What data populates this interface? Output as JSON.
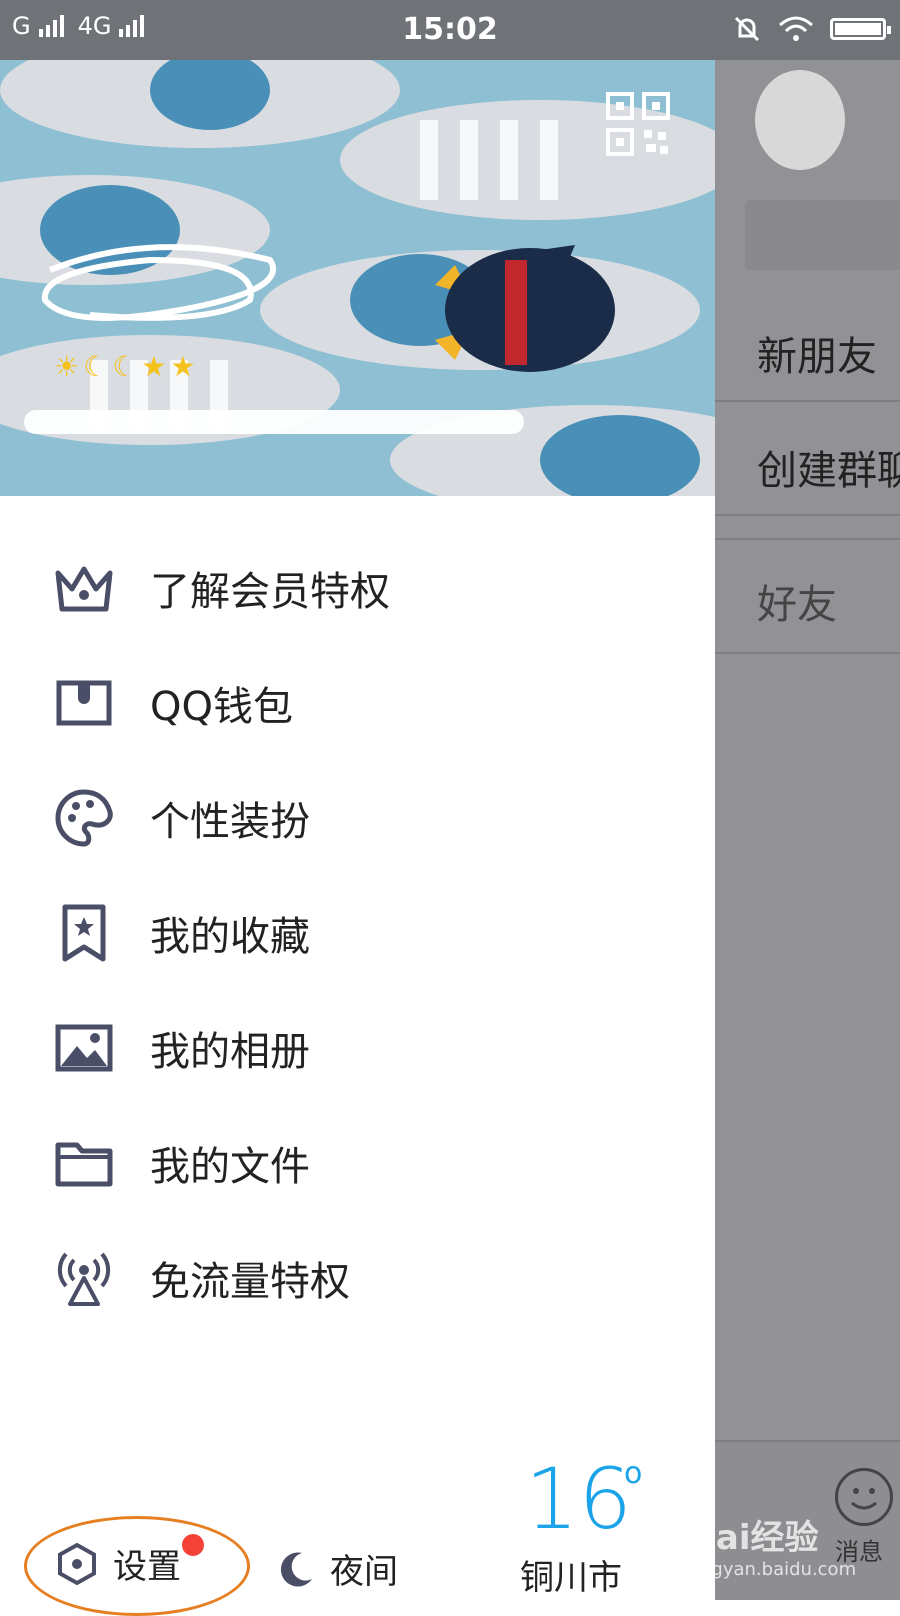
{
  "status_bar": {
    "network_left": "G",
    "network_right": "4G",
    "time": "15:02"
  },
  "menu": [
    {
      "label": "了解会员特权",
      "icon": "crown-icon"
    },
    {
      "label": "QQ钱包",
      "icon": "wallet-icon"
    },
    {
      "label": "个性装扮",
      "icon": "palette-icon"
    },
    {
      "label": "我的收藏",
      "icon": "bookmark-star-icon"
    },
    {
      "label": "我的相册",
      "icon": "photo-icon"
    },
    {
      "label": "我的文件",
      "icon": "folder-icon"
    },
    {
      "label": "免流量特权",
      "icon": "antenna-icon"
    }
  ],
  "bottom": {
    "settings_label": "设置",
    "night_label": "夜间"
  },
  "weather": {
    "temperature": "16",
    "degree": "o",
    "city": "铜川市"
  },
  "background_list": {
    "new_friend": "新朋友",
    "create_group": "创建群聊",
    "friends": "好友",
    "messages": "消息"
  },
  "watermark": {
    "brand": "Bai经验",
    "url": "jingyan.baidu.com"
  },
  "colors": {
    "accent": "#1aa3e8",
    "icon": "#4a4e66",
    "highlight_ring": "#e67e22",
    "badge": "#f44336"
  }
}
